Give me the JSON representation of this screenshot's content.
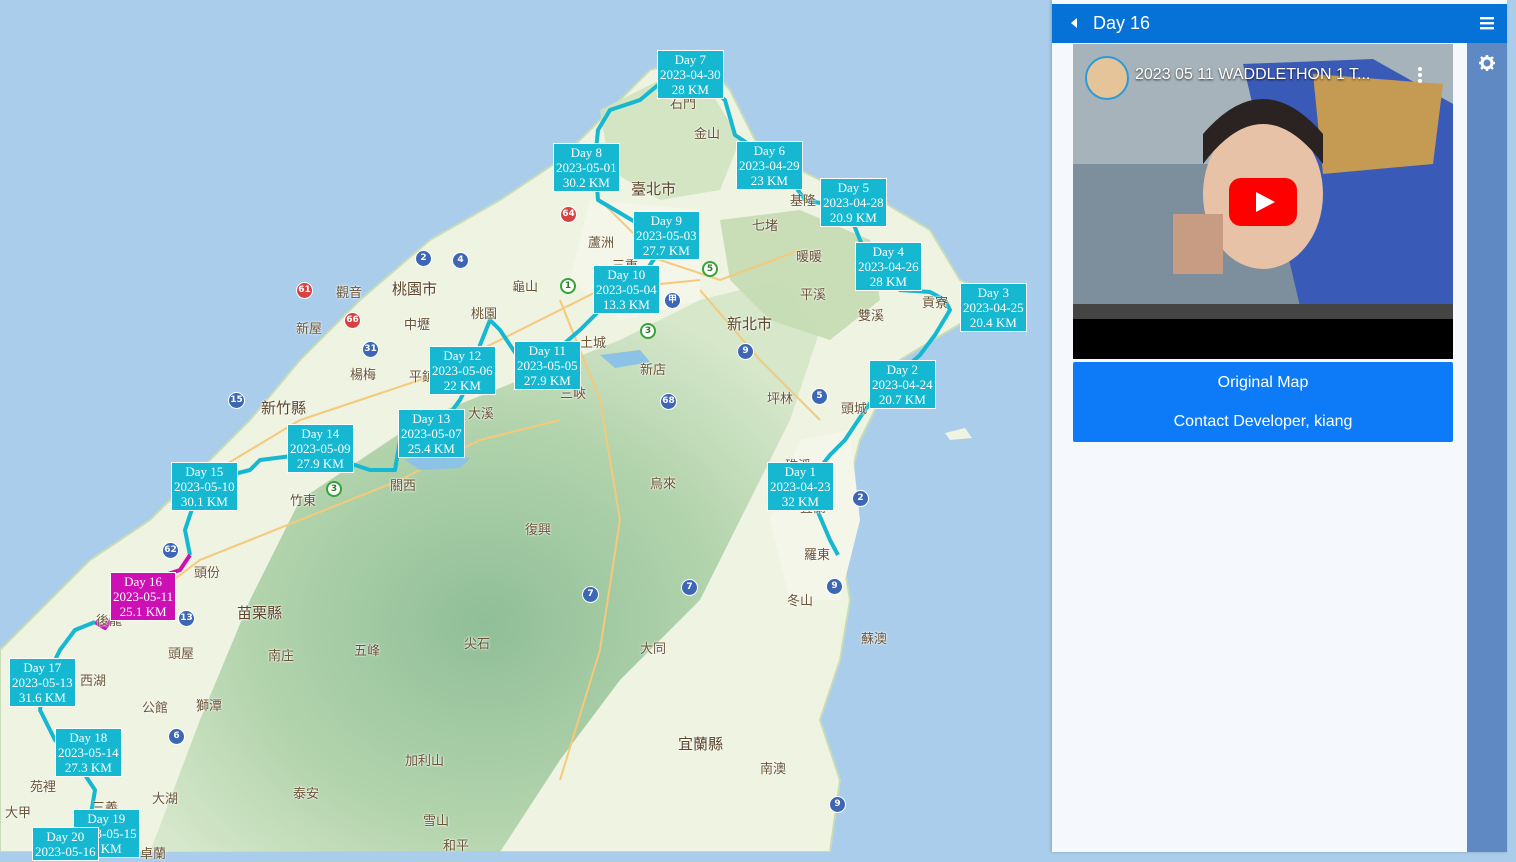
{
  "map": {
    "places": [
      {
        "text": "臺北市",
        "big": true
      },
      {
        "text": "新北市",
        "big": true
      },
      {
        "text": "桃園市",
        "big": true
      },
      {
        "text": "新竹縣",
        "big": true
      },
      {
        "text": "苗栗縣",
        "big": true
      },
      {
        "text": "宜蘭縣",
        "big": true
      },
      {
        "text": "石門"
      },
      {
        "text": "金山"
      },
      {
        "text": "基隆"
      },
      {
        "text": "七堵"
      },
      {
        "text": "暖暖"
      },
      {
        "text": "蘆洲"
      },
      {
        "text": "三重"
      },
      {
        "text": "龜山"
      },
      {
        "text": "觀音"
      },
      {
        "text": "新屋"
      },
      {
        "text": "中壢"
      },
      {
        "text": "楊梅"
      },
      {
        "text": "平鎮"
      },
      {
        "text": "桃園"
      },
      {
        "text": "土城"
      },
      {
        "text": "三峽"
      },
      {
        "text": "新店"
      },
      {
        "text": "大溪"
      },
      {
        "text": "平溪"
      },
      {
        "text": "雙溪"
      },
      {
        "text": "貢寮"
      },
      {
        "text": "坪林"
      },
      {
        "text": "頭城"
      },
      {
        "text": "礁溪"
      },
      {
        "text": "宜蘭"
      },
      {
        "text": "羅東"
      },
      {
        "text": "冬山"
      },
      {
        "text": "蘇澳"
      },
      {
        "text": "烏來"
      },
      {
        "text": "復興"
      },
      {
        "text": "竹東"
      },
      {
        "text": "關西"
      },
      {
        "text": "頭份"
      },
      {
        "text": "後龍"
      },
      {
        "text": "西湖"
      },
      {
        "text": "頭屋"
      },
      {
        "text": "南庄"
      },
      {
        "text": "五峰"
      },
      {
        "text": "尖石"
      },
      {
        "text": "大同"
      },
      {
        "text": "南澳"
      },
      {
        "text": "公館"
      },
      {
        "text": "獅潭"
      },
      {
        "text": "苑裡"
      },
      {
        "text": "大甲"
      },
      {
        "text": "三義"
      },
      {
        "text": "大湖"
      },
      {
        "text": "泰安"
      },
      {
        "text": "加利山"
      },
      {
        "text": "雪山"
      },
      {
        "text": "和平"
      },
      {
        "text": "卓蘭"
      }
    ],
    "shields": [
      "1",
      "2",
      "3",
      "4",
      "5",
      "61",
      "64",
      "66",
      "31",
      "9",
      "7",
      "62",
      "15",
      "13",
      "6",
      "68",
      "甲",
      "2",
      "3",
      "9",
      "7",
      "9",
      "5"
    ],
    "days": [
      {
        "day": "Day 7",
        "date": "2023-04-30",
        "dist": "28 KM"
      },
      {
        "day": "Day 8",
        "date": "2023-05-01",
        "dist": "30.2 KM"
      },
      {
        "day": "Day 6",
        "date": "2023-04-29",
        "dist": "23 KM"
      },
      {
        "day": "Day 5",
        "date": "2023-04-28",
        "dist": "20.9 KM"
      },
      {
        "day": "Day 9",
        "date": "2023-05-03",
        "dist": "27.7 KM"
      },
      {
        "day": "Day 4",
        "date": "2023-04-26",
        "dist": "28 KM"
      },
      {
        "day": "Day 10",
        "date": "2023-05-04",
        "dist": "13.3 KM"
      },
      {
        "day": "Day 3",
        "date": "2023-04-25",
        "dist": "20.4 KM"
      },
      {
        "day": "Day 11",
        "date": "2023-05-05",
        "dist": "27.9 KM"
      },
      {
        "day": "Day 12",
        "date": "2023-05-06",
        "dist": "22 KM"
      },
      {
        "day": "Day 2",
        "date": "2023-04-24",
        "dist": "20.7 KM"
      },
      {
        "day": "Day 13",
        "date": "2023-05-07",
        "dist": "25.4 KM"
      },
      {
        "day": "Day 14",
        "date": "2023-05-09",
        "dist": "27.9 KM"
      },
      {
        "day": "Day 1",
        "date": "2023-04-23",
        "dist": "32 KM"
      },
      {
        "day": "Day 15",
        "date": "2023-05-10",
        "dist": "30.1 KM"
      },
      {
        "day": "Day 16",
        "date": "2023-05-11",
        "dist": "25.1 KM",
        "active": true
      },
      {
        "day": "Day 17",
        "date": "2023-05-13",
        "dist": "31.6 KM"
      },
      {
        "day": "Day 18",
        "date": "2023-05-14",
        "dist": "27.3 KM"
      },
      {
        "day": "Day 19",
        "date": "2023-05-15",
        "dist": "5 KM"
      },
      {
        "day": "Day 20",
        "date": "2023-05-16",
        "dist": ""
      }
    ],
    "route_color": "#16b8d1",
    "active_color": "#cc10b4"
  },
  "sidebar": {
    "title": "Day 16",
    "video_title": "2023 05 11 WADDLETHON 1 T...",
    "links": {
      "original_map": "Original Map",
      "contact": "Contact Developer, kiang"
    },
    "header_color": "#0672d8"
  }
}
